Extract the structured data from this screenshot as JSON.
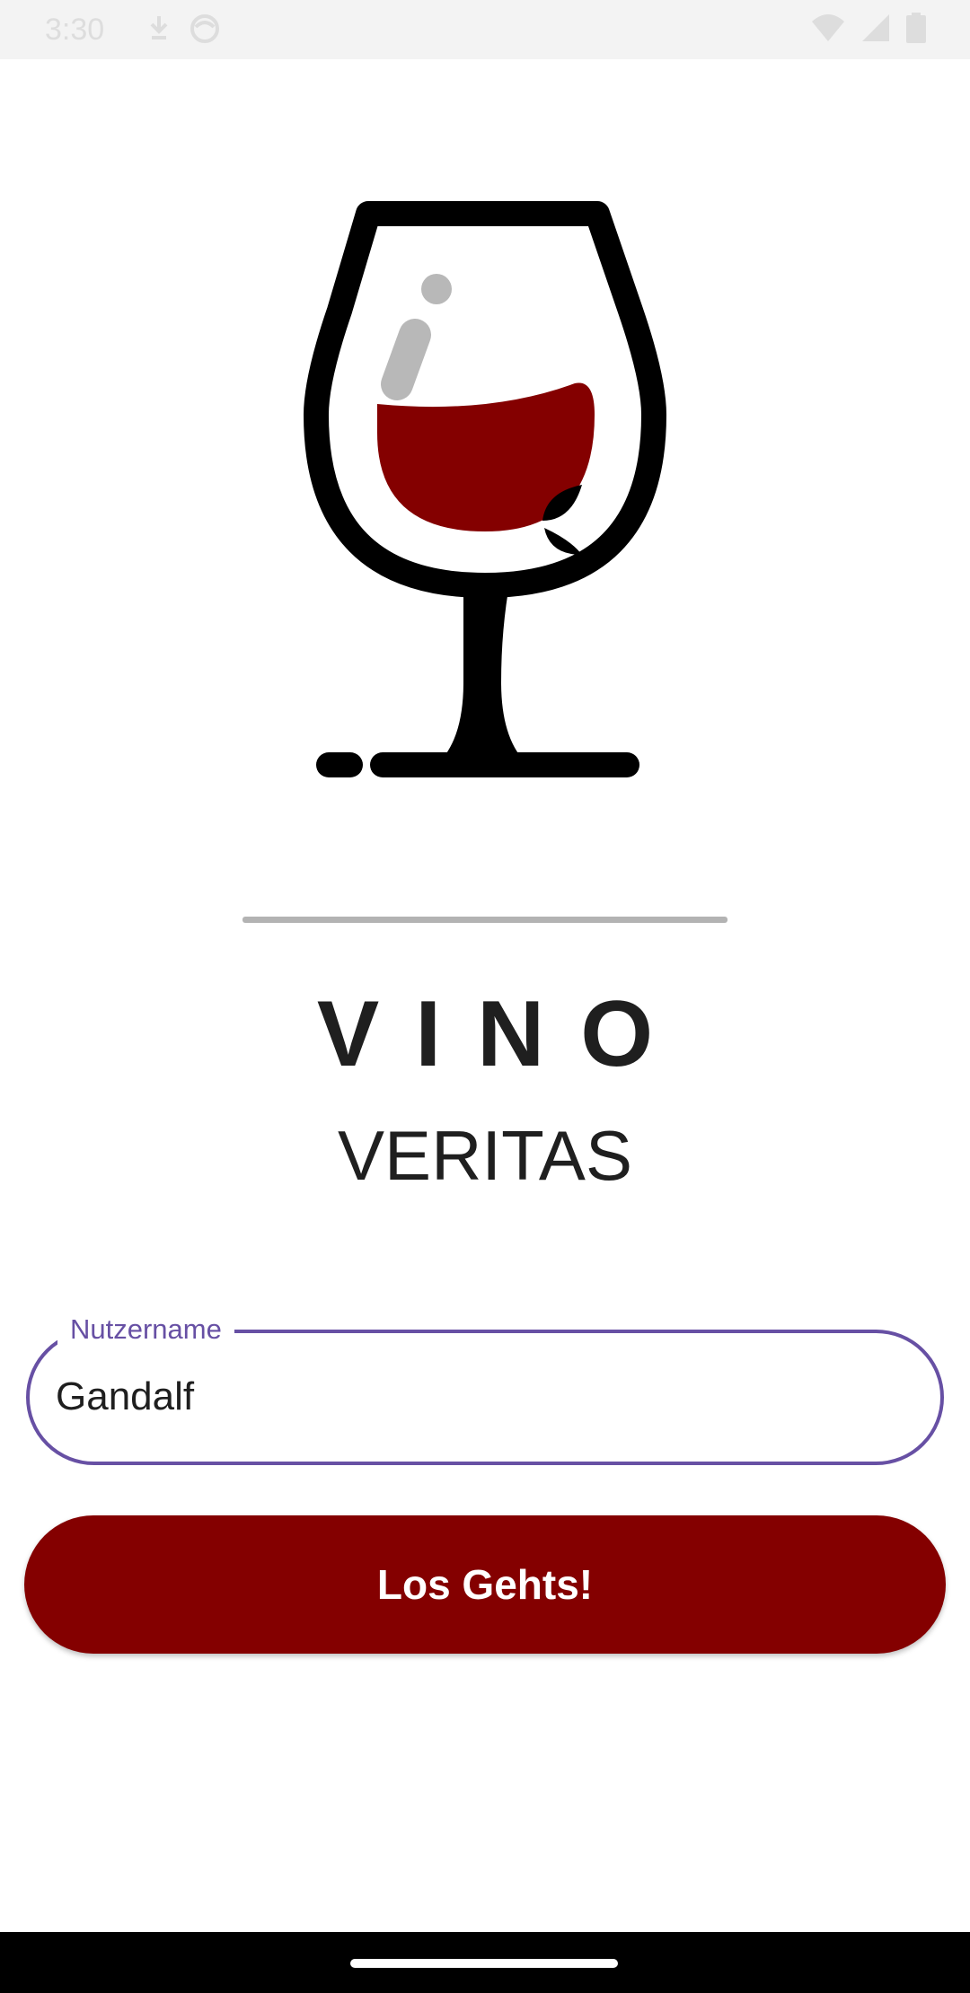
{
  "status_bar": {
    "time": "3:30",
    "left_icons": [
      "download-icon",
      "circle-face-icon"
    ],
    "right_icons": [
      "wifi-icon",
      "cell-signal-icon",
      "battery-icon"
    ]
  },
  "logo": {
    "icon": "wine-glass-icon",
    "colors": {
      "outline": "#000000",
      "wine": "#840000",
      "highlight": "#b8b8b8"
    }
  },
  "app": {
    "title": "VINO",
    "subtitle": "VERITAS"
  },
  "username_field": {
    "label": "Nutzername",
    "value": "Gandalf",
    "accent_color": "#6750a4"
  },
  "submit_button": {
    "label": "Los Gehts!",
    "color": "#840000"
  }
}
